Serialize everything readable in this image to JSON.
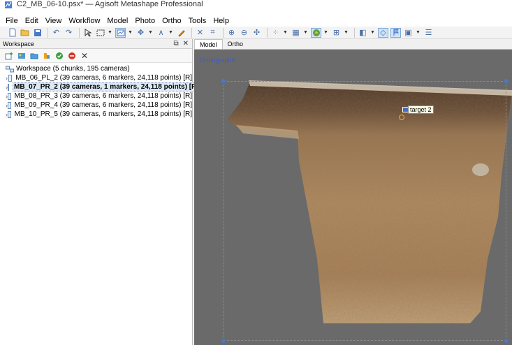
{
  "window": {
    "title": "C2_MB_06-10.psx* — Agisoft Metashape Professional"
  },
  "menu": [
    "File",
    "Edit",
    "View",
    "Workflow",
    "Model",
    "Photo",
    "Ortho",
    "Tools",
    "Help"
  ],
  "workspace": {
    "panel_title": "Workspace",
    "root_label": "Workspace (5 chunks, 195 cameras)",
    "chunks": [
      {
        "label": "MB_06_PL_2 (39 cameras, 6 markers, 24,118 points) [R]",
        "active": false
      },
      {
        "label": "MB_07_PR_2 (39 cameras, 1 markers, 24,118 points) [R]",
        "active": true
      },
      {
        "label": "MB_08_PR_3 (39 cameras, 6 markers, 24,118 points) [R]",
        "active": false
      },
      {
        "label": "MB_09_PR_4 (39 cameras, 6 markers, 24,118 points) [R]",
        "active": false
      },
      {
        "label": "MB_10_PR_5 (39 cameras, 6 markers, 24,118 points) [R]",
        "active": false
      }
    ]
  },
  "viewport": {
    "tabs": [
      "Model",
      "Ortho"
    ],
    "active_tab": "Model",
    "projection_label": "Orthographic",
    "marker_label": "target 2"
  },
  "colors": {
    "accent": "#3a5bd8",
    "background_view": "#6a6a6a",
    "soil_dark": "#5a4030",
    "soil_light": "#b08a60"
  }
}
